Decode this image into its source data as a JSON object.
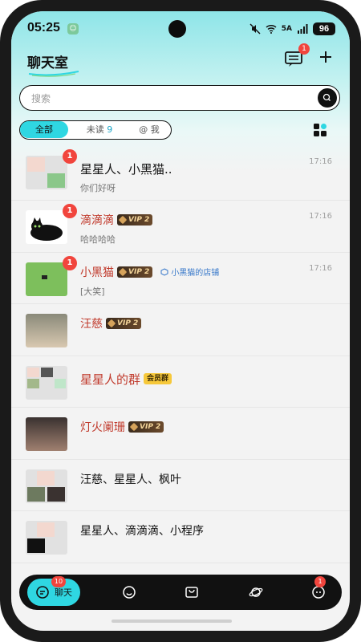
{
  "status_bar": {
    "time": "05:25",
    "network": "5A",
    "battery": "96"
  },
  "header": {
    "title": "聊天室",
    "message_badge": "1"
  },
  "search": {
    "placeholder": "搜索"
  },
  "tabs": {
    "all": "全部",
    "unread_label": "未读",
    "unread_count": "9",
    "at_me": "@ 我"
  },
  "chats": [
    {
      "name": "星星人、小黑猫..",
      "preview": "你们好呀",
      "time": "17:16",
      "badge": "1"
    },
    {
      "name": "滴滴滴",
      "vip": "VIP 2",
      "preview": "哈哈哈哈",
      "time": "17:16",
      "badge": "1"
    },
    {
      "name": "小黑猫",
      "vip": "VIP 2",
      "shop": "小黑猫的店铺",
      "preview": "[大笑]",
      "time": "17:16",
      "badge": "1"
    },
    {
      "name": "汪慈",
      "vip": "VIP 2"
    },
    {
      "name": "星星人的群",
      "member": "会员群"
    },
    {
      "name": "灯火阑珊",
      "vip": "VIP 2"
    },
    {
      "name": "汪慈、星星人、枫叶"
    },
    {
      "name": "星星人、滴滴滴、小程序"
    }
  ],
  "nav": {
    "chat_label": "聊天",
    "chat_badge": "10",
    "last_badge": "1"
  },
  "colors": {
    "accent": "#2fd7e2",
    "badge": "#f1453d",
    "vip_name": "#c0392b"
  }
}
